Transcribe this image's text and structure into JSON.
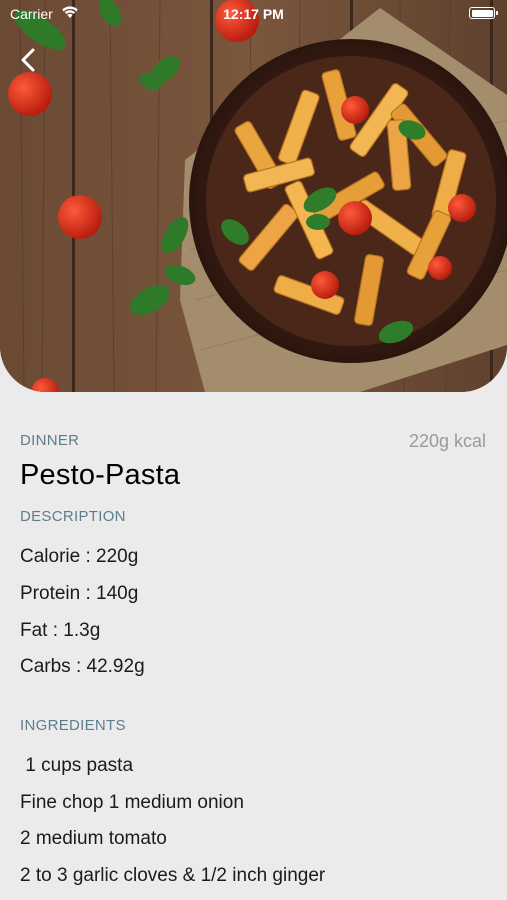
{
  "status_bar": {
    "carrier": "Carrier",
    "time": "12:17 PM"
  },
  "hero": {
    "image": "pesto-pasta-photo",
    "back_icon": "chevron-left-icon"
  },
  "recipe": {
    "category": "DINNER",
    "kcal": "220g kcal",
    "title": "Pesto-Pasta",
    "description_heading": "DESCRIPTION",
    "nutrition": [
      "Calorie : 220g",
      "Protein : 140g",
      "Fat : 1.3g",
      "Carbs : 42.92g"
    ],
    "ingredients_heading": "INGREDIENTS",
    "ingredients": [
      " 1 cups pasta",
      "Fine chop 1 medium onion",
      "2 medium tomato",
      "2 to 3 garlic cloves & 1/2 inch ginger"
    ]
  },
  "colors": {
    "accent": "#5d7d8c",
    "muted": "#9a9a9a",
    "background": "#ebebeb"
  }
}
